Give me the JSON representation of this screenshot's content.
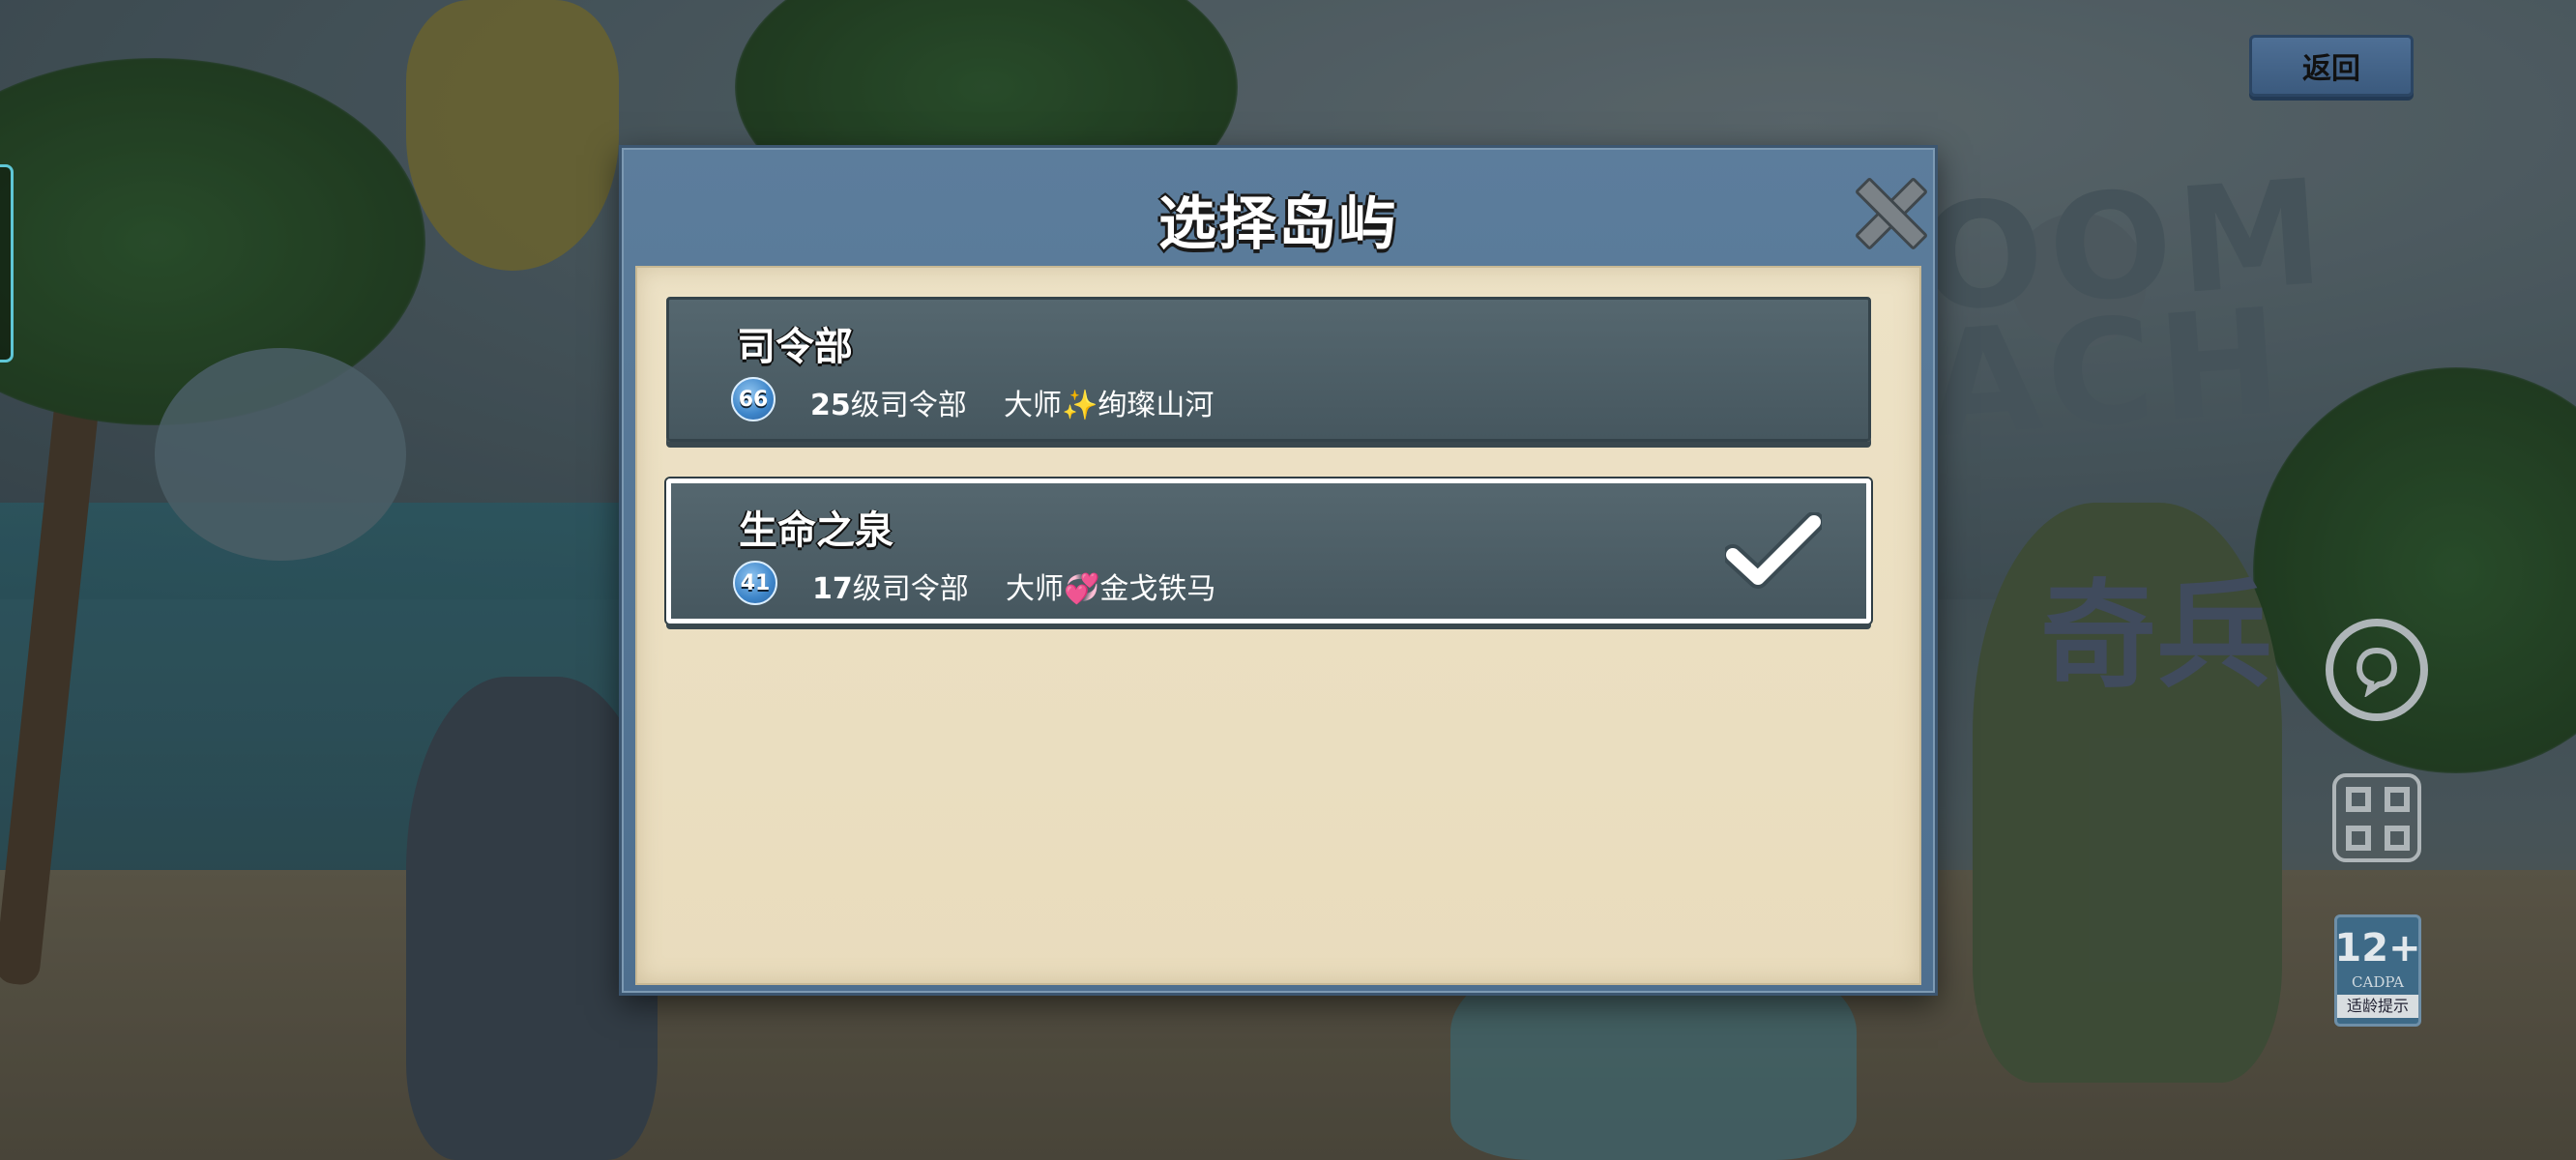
{
  "top_bar": {
    "back_label": "返回"
  },
  "dialog": {
    "title": "选择岛屿",
    "islands": [
      {
        "name": "司令部",
        "level_badge": "66",
        "hq_level_number": "25",
        "hq_level_suffix": "级司令部",
        "owner": "大师✨绚璨山河",
        "selected": false
      },
      {
        "name": "生命之泉",
        "level_badge": "41",
        "hq_level_number": "17",
        "hq_level_suffix": "级司令部",
        "owner": "大师💞金戈铁马",
        "selected": true
      }
    ]
  },
  "side_panel": {
    "age_rating": "12+",
    "age_org": "CADPA",
    "age_tip": "适龄提示"
  },
  "background": {
    "logo_text": "OOM\nACH",
    "logo_subtext": "奇兵"
  },
  "colors": {
    "dialog_frame": "#5c7d9c",
    "panel_paper": "#ede2c6",
    "row_background": "#4e5f67",
    "selected_border": "#ffffff",
    "level_badge": "#3d85c9",
    "back_button": "#4e6f95"
  },
  "icons": {
    "close": "close-icon",
    "selected": "checkmark-icon",
    "chat": "chat-icon",
    "scan": "scan-icon"
  }
}
